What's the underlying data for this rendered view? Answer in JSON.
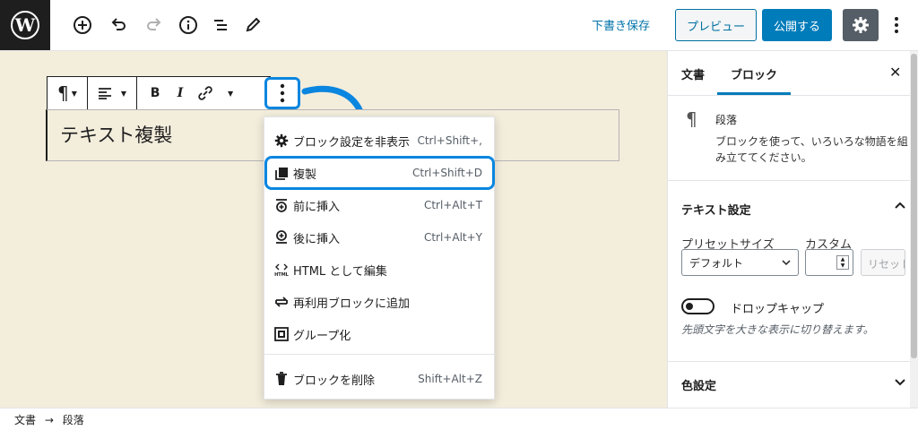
{
  "topbar": {
    "save_draft": "下書き保存",
    "preview": "プレビュー",
    "publish": "公開する"
  },
  "block": {
    "content": "テキスト複製"
  },
  "menu": {
    "items": [
      {
        "label": "ブロック設定を非表示",
        "shortcut": "Ctrl+Shift+,"
      },
      {
        "label": "複製",
        "shortcut": "Ctrl+Shift+D"
      },
      {
        "label": "前に挿入",
        "shortcut": "Ctrl+Alt+T"
      },
      {
        "label": "後に挿入",
        "shortcut": "Ctrl+Alt+Y"
      },
      {
        "label": "HTML として編集",
        "shortcut": ""
      },
      {
        "label": "再利用ブロックに追加",
        "shortcut": ""
      },
      {
        "label": "グループ化",
        "shortcut": ""
      },
      {
        "label": "ブロックを削除",
        "shortcut": "Shift+Alt+Z"
      }
    ]
  },
  "sidebar": {
    "tab_document": "文書",
    "tab_block": "ブロック",
    "block_title": "段落",
    "block_desc": "ブロックを使って、いろいろな物語を組み立ててください。",
    "text_settings": "テキスト設定",
    "preset_size_label": "プリセットサイズ",
    "custom_label": "カスタム",
    "preset_value": "デフォルト",
    "reset_label": "リセット",
    "dropcap_label": "ドロップキャップ",
    "dropcap_help": "先頭文字を大きな表示に切り替えます。",
    "color_settings": "色設定"
  },
  "footer": {
    "crumb_document": "文書",
    "arrow": "→",
    "crumb_block": "段落"
  },
  "colors": {
    "accent": "#007cba",
    "highlight": "#0a86e0",
    "canvas_bg": "#f3eddc"
  }
}
